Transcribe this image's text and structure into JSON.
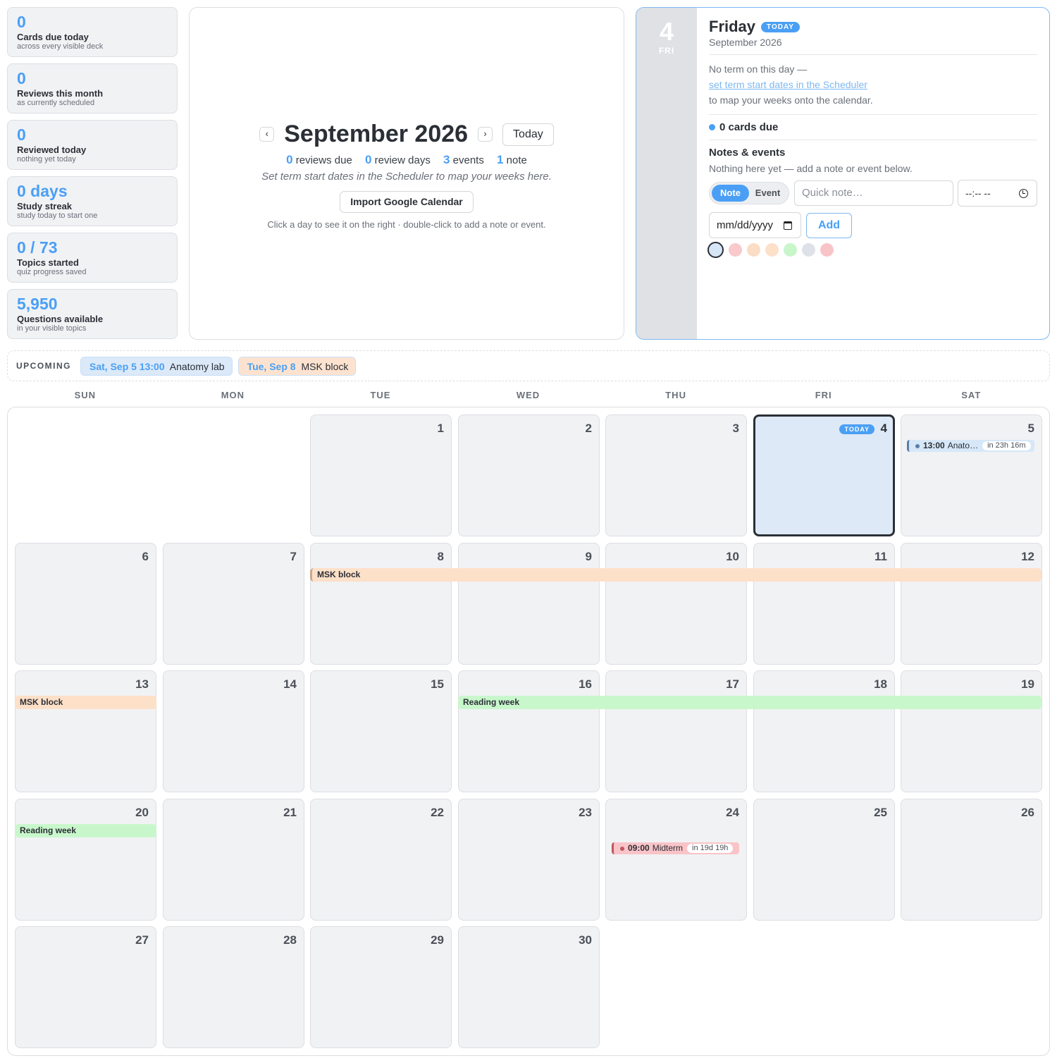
{
  "stats": [
    {
      "value": "0",
      "label": "Cards due today",
      "sub": "across every visible deck"
    },
    {
      "value": "0",
      "label": "Reviews this month",
      "sub": "as currently scheduled"
    },
    {
      "value": "0",
      "label": "Reviewed today",
      "sub": "nothing yet today"
    },
    {
      "value": "0 days",
      "label": "Study streak",
      "sub": "study today to start one"
    },
    {
      "value": "0 / 73",
      "label": "Topics started",
      "sub": "quiz progress saved"
    },
    {
      "value": "5,950",
      "label": "Questions available",
      "sub": "in your visible topics"
    }
  ],
  "month_header": {
    "prev_icon": "‹",
    "next_icon": "›",
    "title": "September 2026",
    "today_label": "Today",
    "reviews_due": "0",
    "reviews_due_label": "reviews due",
    "review_days": "0",
    "review_days_label": "review days",
    "events": "3",
    "events_label": "events",
    "notes": "1",
    "notes_label": "note",
    "hint": "Set term start dates in the Scheduler to map your weeks here.",
    "import_label": "Import Google Calendar",
    "help": "Click a day to see it on the right · double-click to add a note or event."
  },
  "day_panel": {
    "day_num": "4",
    "dow_short": "FRI",
    "weekday": "Friday",
    "today_badge": "TODAY",
    "month_year": "September 2026",
    "no_term": "No term on this day —",
    "term_link": "set term start dates in the Scheduler",
    "term_after": "to map your weeks onto the calendar.",
    "cards_due": "0 cards due",
    "notes_heading": "Notes & events",
    "notes_empty": "Nothing here yet — add a note or event below.",
    "toggle_note": "Note",
    "toggle_event": "Event",
    "quick_placeholder": "Quick note…",
    "time_value": "--:-- --",
    "date_value": "mm/dd/yyyy",
    "add_label": "Add",
    "swatches": [
      "#d6e6f7",
      "#f9c9cc",
      "#fbdcc4",
      "#fde0c8",
      "#c9f5cb",
      "#dfe1e9",
      "#f9c4c8"
    ]
  },
  "upcoming": {
    "label": "UPCOMING",
    "items": [
      {
        "when": "Sat, Sep 5 13:00",
        "what": "Anatomy lab",
        "bg": "#dbe9f8",
        "accent": "#4a9ff5"
      },
      {
        "when": "Tue, Sep 8",
        "what": "MSK block",
        "bg": "#fde3cf",
        "accent": "#4a9ff5"
      }
    ]
  },
  "calendar": {
    "weekdays": [
      "SUN",
      "MON",
      "TUE",
      "WED",
      "THU",
      "FRI",
      "SAT"
    ],
    "today_badge": "TODAY",
    "days": [
      "1",
      "2",
      "3",
      "4",
      "5",
      "6",
      "7",
      "8",
      "9",
      "10",
      "11",
      "12",
      "13",
      "14",
      "15",
      "16",
      "17",
      "18",
      "19",
      "20",
      "21",
      "22",
      "23",
      "24",
      "25",
      "26",
      "27",
      "28",
      "29",
      "30"
    ],
    "bars": [
      {
        "label": "MSK block",
        "color": "#fde0c8"
      },
      {
        "label": "MSK block",
        "color": "#fde0c8"
      },
      {
        "label": "Reading week",
        "color": "#c9f7cc"
      },
      {
        "label": "Reading week",
        "color": "#c9f7cc"
      }
    ],
    "events": [
      {
        "time": "13:00",
        "name": "Anato…",
        "countdown": "in 23h 16m",
        "bg": "#d6e7f8",
        "dot": "#5b7fa6"
      },
      {
        "time": "09:00",
        "name": "Midterm",
        "countdown": "in 19d 19h",
        "bg": "#f9c4c8",
        "dot": "#c0565f"
      }
    ]
  }
}
